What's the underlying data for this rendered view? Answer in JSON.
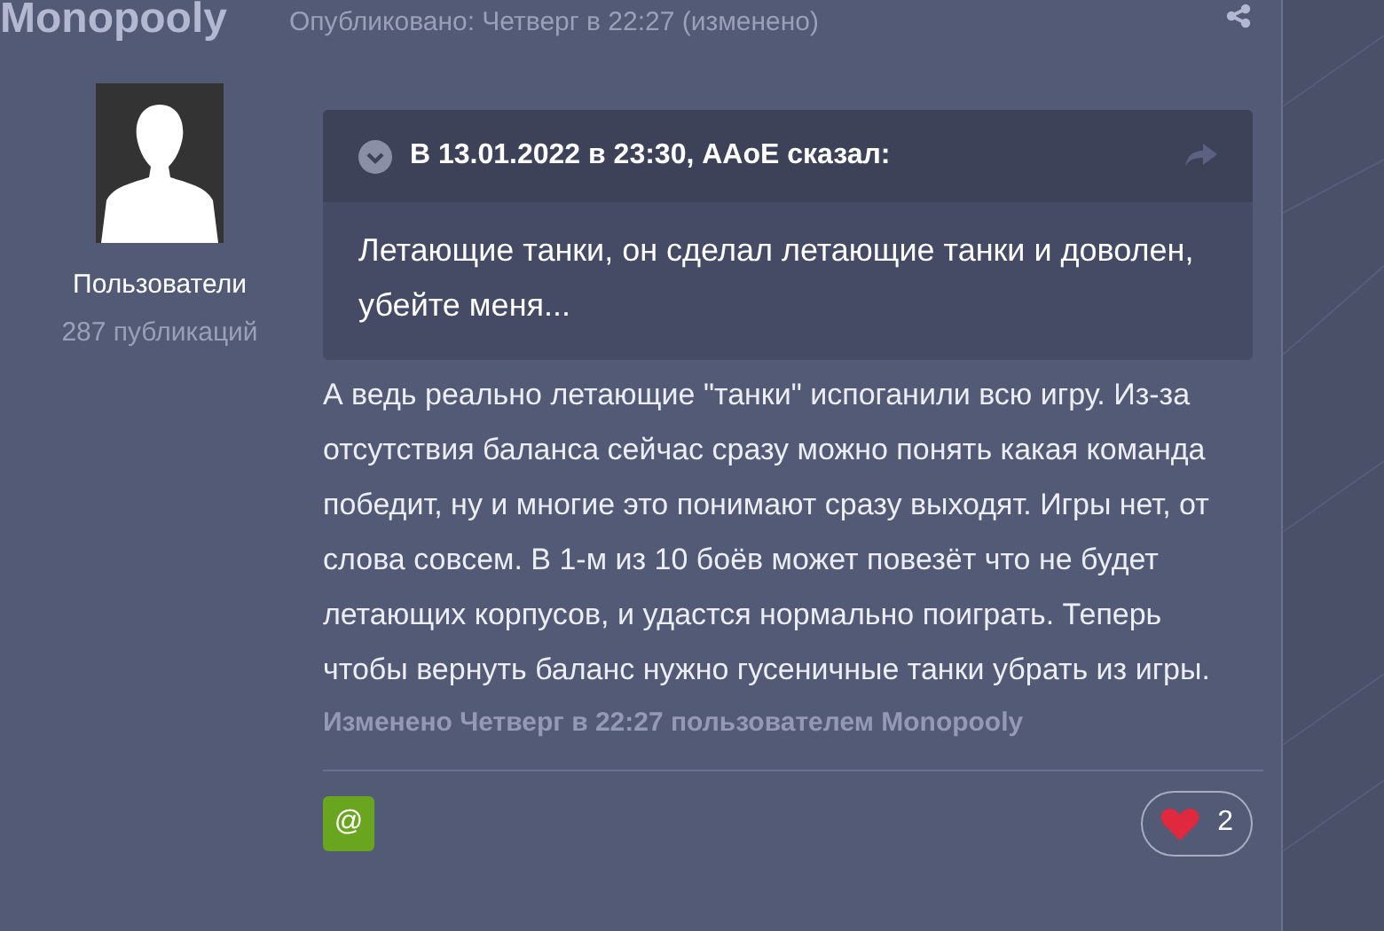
{
  "author": {
    "name": "Monopooly",
    "group": "Пользователи",
    "posts": "287 публикаций"
  },
  "post": {
    "published": "Опубликовано: Четверг в 22:27 (изменено)",
    "quote": {
      "header": "В 13.01.2022 в 23:30, AAoE сказал:",
      "text": "Летающие танки, он сделал летающие танки и доволен, убейте меня..."
    },
    "body": "А ведь реально летающие \"танки\" испоганили всю игру. Из-за отсутствия баланса сейчас сразу можно понять какая команда победит, ну и многие это понимают сразу выходят. Игры нет, от слова совсем. В 1-м из 10 боёв может повезёт что не будет летающих корпусов, и удастся нормально поиграть. Теперь чтобы вернуть баланс нужно гусеничные танки убрать из игры.",
    "edited": "Изменено Четверг в 22:27 пользователем Monopooly",
    "mention_button": "@",
    "likes": "2"
  }
}
